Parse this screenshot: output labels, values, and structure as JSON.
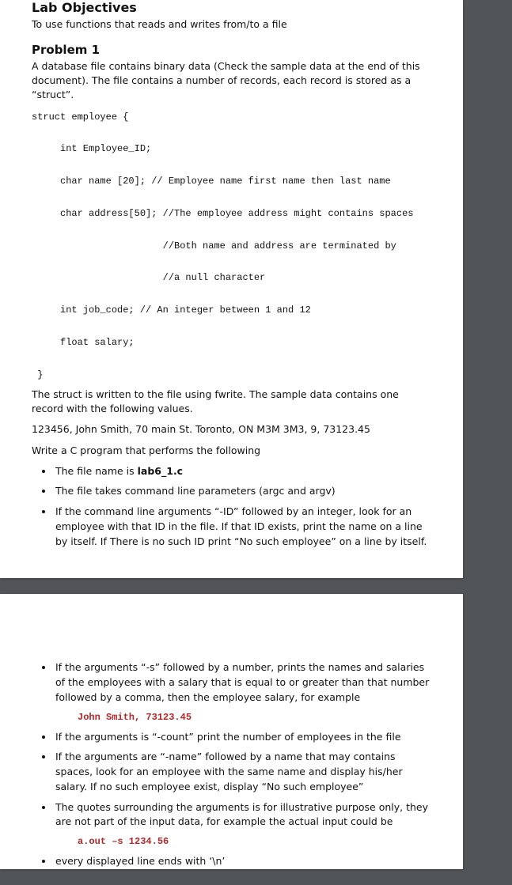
{
  "page1": {
    "heading_objectives": "Lab Objectives",
    "objectives_text": "To use functions that reads and writes from/to a file",
    "heading_problem": "Problem 1",
    "problem_intro": "A database file contains binary data (Check the sample data at the end of this document). The file contains a number of records, each record is stored as a “struct”.",
    "code_block": "struct employee {\n\n     int Employee_ID;\n\n     char name [20]; // Employee name first name then last name\n\n     char address[50]; //The employee address might contains spaces\n\n                       //Both name and address are terminated by\n\n                       //a null character\n\n     int job_code; // An integer between 1 and 12\n\n     float salary;\n\n }",
    "after_code": "The struct is written to the file using fwrite. The sample data contains one record with the following values.",
    "sample_record": "123456, John Smith, 70 main St. Toronto, ON M3M 3M3, 9, 73123.45",
    "write_program": "Write a C program that performs the following",
    "bullets": {
      "b1_pre": "The file name is ",
      "b1_bold": "lab6_1.c",
      "b2": "The file takes command line parameters (argc and argv)",
      "b3": "If the command line arguments “-ID” followed by an integer, look for an employee with that ID in the file. If that ID exists, print the name on a line by itself. If There is no such ID print “No such employee” on a line by itself."
    }
  },
  "page2": {
    "bullets": {
      "b1": "If the arguments “-s” followed by a number, prints the names and salaries of the employees with a salary that is equal to or greater than that number followed by a comma, then the employee salary, for example",
      "b1_example": "John Smith, 73123.45",
      "b2": "If the arguments is “-count” print the number of employees in the file",
      "b3": "If the arguments are “-name” followed by a name that may contains spaces, look for an employee with the same name and display his/her salary. If no such employee exist, display “No such employee”",
      "b4": "The quotes surrounding the arguments is for illustrative purpose only, they are not part of the input data, for example the actual input could be",
      "b4_example": "a.out –s 1234.56",
      "b5": "every displayed line ends with ‘\\n’"
    }
  }
}
